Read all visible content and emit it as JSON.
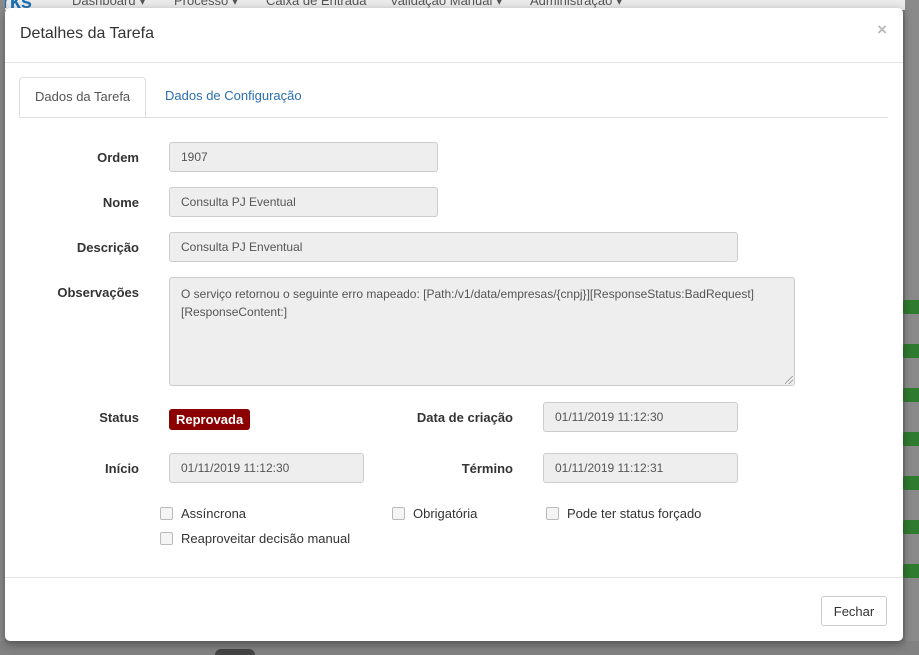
{
  "background": {
    "brand": "rks",
    "menu": [
      "Dashboard ▾",
      "Processo ▾",
      "Caixa de Entrada",
      "Validação Manual ▾",
      "Administração ▾"
    ]
  },
  "modal": {
    "title": "Detalhes da Tarefa",
    "close_glyph": "×",
    "tabs": [
      {
        "label": "Dados da Tarefa",
        "active": true
      },
      {
        "label": "Dados de Configuração",
        "active": false
      }
    ],
    "fields": {
      "ordem": {
        "label": "Ordem",
        "value": "1907"
      },
      "nome": {
        "label": "Nome",
        "value": "Consulta PJ Eventual"
      },
      "descricao": {
        "label": "Descrição",
        "value": "Consulta PJ Enventual"
      },
      "observacoes": {
        "label": "Observações",
        "value": "O serviço retornou o seguinte erro mapeado: [Path:/v1/data/empresas/{cnpj}][ResponseStatus:BadRequest][ResponseContent:]"
      },
      "status": {
        "label": "Status",
        "value": "Reprovada",
        "color": "#8b0000"
      },
      "data_criacao": {
        "label": "Data de criação",
        "value": "01/11/2019 11:12:30"
      },
      "inicio": {
        "label": "Início",
        "value": "01/11/2019 11:12:30"
      },
      "termino": {
        "label": "Término",
        "value": "01/11/2019 11:12:31"
      }
    },
    "checkboxes": {
      "assincrona": {
        "label": "Assíncrona",
        "checked": false
      },
      "obrigatoria": {
        "label": "Obrigatória",
        "checked": false
      },
      "pode_forcado": {
        "label": "Pode ter status forçado",
        "checked": false
      },
      "reaproveitar": {
        "label": "Reaproveitar decisão manual",
        "checked": false
      }
    },
    "footer": {
      "close_label": "Fechar"
    }
  }
}
